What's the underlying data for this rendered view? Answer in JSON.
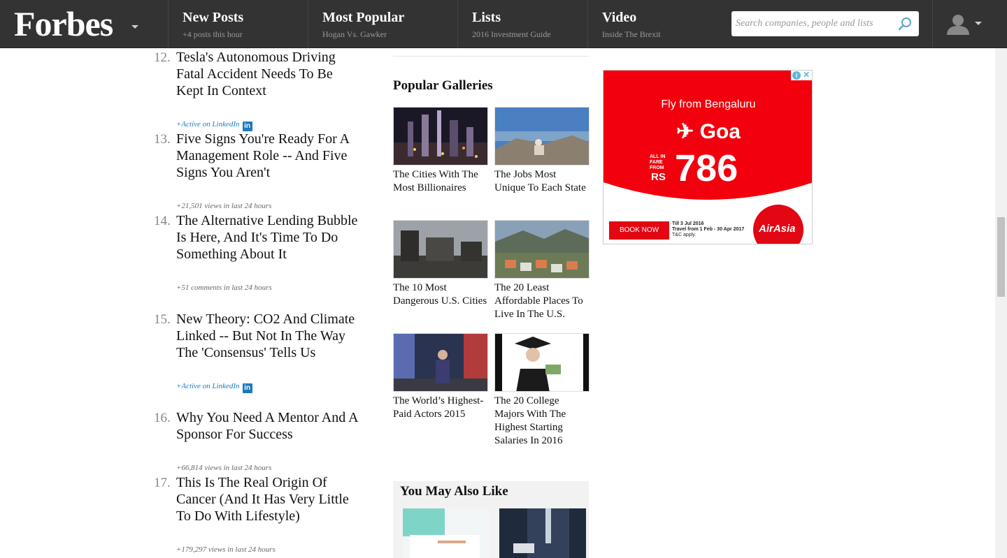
{
  "header": {
    "logo": "Forbes",
    "nav": [
      {
        "title": "New Posts",
        "sub": "+4 posts this hour"
      },
      {
        "title": "Most Popular",
        "sub": "Hogan Vs. Gawker"
      },
      {
        "title": "Lists",
        "sub": "2016 Investment Guide"
      },
      {
        "title": "Video",
        "sub": "Inside The Brexit"
      }
    ],
    "search_placeholder": "Search companies, people and lists"
  },
  "list": [
    {
      "num": "12.",
      "title": "Tesla's Autonomous Driving Fatal Accident Needs To Be Kept In Context",
      "meta": "+Active on LinkedIn"
    },
    {
      "num": "13.",
      "title": "Five Signs You're Ready For A Management Role -- And Five Signs You Aren't",
      "meta": "+21,501 views in last 24 hours"
    },
    {
      "num": "14.",
      "title": "The Alternative Lending Bubble Is Here, And It's Time To Do Something About It",
      "meta": "+51 comments in last 24 hours"
    },
    {
      "num": "15.",
      "title": "New Theory: CO2 And Climate Linked -- But Not In The Way The 'Consensus' Tells Us",
      "meta": "+Active on LinkedIn"
    },
    {
      "num": "16.",
      "title": "Why You Need A Mentor And A Sponsor For Success",
      "meta": "+66,814 views in last 24 hours"
    },
    {
      "num": "17.",
      "title": "This Is The Real Origin Of Cancer (And It Has Very Little To Do With Lifestyle)",
      "meta": "+179,297 views in last 24 hours"
    }
  ],
  "linkedin_badge": "in",
  "galleries": {
    "title": "Popular Galleries",
    "items": [
      {
        "caption": "The Cities With The Most Billionaires"
      },
      {
        "caption": "The Jobs Most Unique To Each State"
      },
      {
        "caption": "The 10 Most Dangerous U.S. Cities"
      },
      {
        "caption": "The 20 Least Affordable Places To Live In The U.S."
      },
      {
        "caption": "The World’s Highest-Paid Actors 2015"
      },
      {
        "caption": "The 20 College Majors With The Highest Starting Salaries In 2016"
      }
    ]
  },
  "you_may_also_like": {
    "title": "You May Also Like"
  },
  "ad": {
    "fly": "Fly from Bengaluru",
    "dest": "Goa",
    "fare_note": "ALL IN FARE FROM",
    "currency": "RS",
    "price": "786",
    "book": "BOOK NOW",
    "terms_1": "Till 3 Jul 2016",
    "terms_2": "Travel from 1 Feb - 30 Apr 2017",
    "terms_3": "T&C apply.",
    "brand": "AirAsia",
    "info": "i",
    "close": "✕"
  }
}
